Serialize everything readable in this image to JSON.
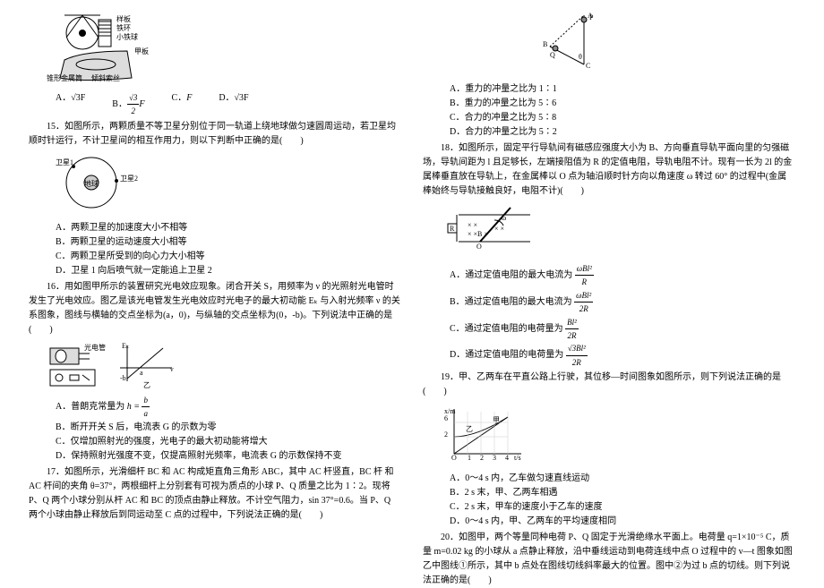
{
  "left": {
    "fig14_labels": {
      "a": "样板",
      "b": "铁环",
      "c": "小铁球",
      "d": "甲板",
      "e": "锥形金属筒",
      "f": "倾斜索丝"
    },
    "q14_options": {
      "A": "√3F",
      "B_frac_num": "√3",
      "B_frac_den": "2",
      "B_suffix": "F",
      "C": "F",
      "D": "√3F"
    },
    "q15_stem": "15．如图所示，两颗质量不等卫星分别位于同一轨道上绕地球做匀速圆周运动，若卫星均顺时针运行，不计卫星间的相互作用力，则以下判断中正确的是(　　)",
    "q15_fig": {
      "center": "地球",
      "a": "卫星1",
      "b": "卫星2"
    },
    "q15_A": "A．两颗卫星的加速度大小不相等",
    "q15_B": "B．两颗卫星的运动速度大小相等",
    "q15_C": "C．两颗卫星所受到的向心力大小相等",
    "q15_D": "D．卫星 1 向后喷气就一定能追上卫星 2",
    "q16_stem": "16．用如图甲所示的装置研究光电效应现象。闭合开关 S，用频率为 ν 的光照射光电管时发生了光电效应。图乙是该光电管发生光电效应时光电子的最大初动能 Eₖ 与入射光频率 ν 的关系图象，图线与横轴的交点坐标为(a，0)，与纵轴的交点坐标为(0，-b)。下列说法中正确的是(　　)",
    "q16_fig": {
      "a": "光电管",
      "b": "乙"
    },
    "q16_A_prefix": "A．普朗克常量为",
    "q16_A_frac_num": "b",
    "q16_A_frac_den": "a",
    "q16_A_pre": "h =",
    "q16_B": "B．断开开关 S 后，电流表 G 的示数为零",
    "q16_C": "C．仅增加照射光的强度，光电子的最大初动能将增大",
    "q16_D": "D．保持照射光强度不变，仅提高照射光频率，电流表 G 的示数保持不变",
    "q17_stem": "17．如图所示，光滑细杆 BC 和 AC 构成矩直角三角形 ABC，其中 AC 杆竖直，BC 杆 和 AC 杆间的夹角 θ=37°，两根细杆上分别套有可视为质点的小球 P、Q 质量之比为 1∶2。现将 P、Q 两个小球分别从杆 AC 和 BC 的顶点由静止释放。不计空气阻力，sin 37°=0.6。当 P、Q 两个小球由静止释放后到同运动至 C 点的过程中，下列说法正确的是(　　)"
  },
  "right": {
    "q17_A": "A．重力的冲量之比为 1∶1",
    "q17_B": "B．重力的冲量之比为 5∶6",
    "q17_C": "C．合力的冲量之比为 5∶8",
    "q17_D": "D．合力的冲量之比为 5∶2",
    "q18_stem": "18．如图所示，固定平行导轨间有磁感应强度大小为 B、方向垂直导轨平面向里的匀强磁场，导轨间距为 l 且足够长，左端接阻值为 R 的定值电阻，导轨电阻不计。现有一长为 2l 的金属棒垂直放在导轨上，在金属棒以 O 点为轴沿顺时针方向以角速度 ω 转过 60° 的过程中(金属棒始终与导轨接触良好，电阻不计)(　　)",
    "q18_A_prefix": "A．通过定值电阻的最大电流为",
    "q18_A_num": "ωBl²",
    "q18_A_den": "R",
    "q18_B_prefix": "B．通过定值电阻的最大电流为",
    "q18_B_num": "ωBl²",
    "q18_B_den": "2R",
    "q18_C_prefix": "C．通过定值电阻的电荷量为",
    "q18_C_num": "Bl²",
    "q18_C_den": "2R",
    "q18_D_prefix": "D．通过定值电阻的电荷量为",
    "q18_D_num": "√3Bl²",
    "q18_D_den": "2R",
    "q19_stem": "19．甲、乙两车在平直公路上行驶，其位移—时间图象如图所示，则下列说法正确的是(　　)",
    "q19_A": "A．0～4 s 内，乙车做匀速直线运动",
    "q19_B": "B．2 s 末，甲、乙两车相遇",
    "q19_C": "C．2 s 末，甲车的速度小于乙车的速度",
    "q19_D": "D．0～4 s 内，甲、乙两车的平均速度相同",
    "q20_stem": "20．如图甲，两个等量同种电荷 P、Q 固定于光滑绝缘水平面上。电荷量 q=1×10⁻⁵ C，质量 m=0.02 kg 的小球从 a 点静止释放，沿中垂线运动到电荷连线中点 O 过程中的 v—t 图象如图乙中图线①所示，其中 b 点处在图线切线斜率最大的位置。图中②为过 b 点的切线。则下列说法正确的是(　　)"
  }
}
